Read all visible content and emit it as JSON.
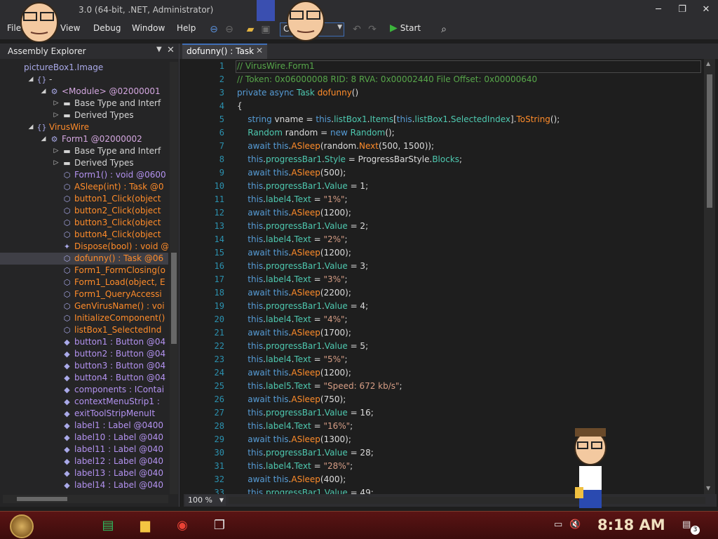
{
  "window": {
    "title": "3.0 (64-bit, .NET, Administrator)",
    "min_glyph": "─",
    "max_glyph": "❐",
    "close_glyph": "✕"
  },
  "menu": {
    "file": "File",
    "view": "View",
    "debug": "Debug",
    "window": "Window",
    "help": "Help"
  },
  "toolbar": {
    "language": "C#",
    "start_label": "Start"
  },
  "assembly_explorer": {
    "title": "Assembly Explorer",
    "rows": [
      {
        "indent": 1,
        "toggle": "",
        "icon": "",
        "icon_name": "resource-icon",
        "text": "pictureBox1.Image",
        "cls": "c-type"
      },
      {
        "indent": 3,
        "toggle": "◢",
        "icon": "{}",
        "icon_name": "namespace-icon",
        "text": "-",
        "cls": "c-ns"
      },
      {
        "indent": 4,
        "toggle": "◢",
        "icon": "⚙",
        "icon_name": "module-icon",
        "text": "<Module> @02000001",
        "cls": "c-mod"
      },
      {
        "indent": 5,
        "toggle": "▷",
        "icon": "▬",
        "icon_name": "folder-icon",
        "text": "Base Type and Interf",
        "cls": "c-folder"
      },
      {
        "indent": 5,
        "toggle": "▷",
        "icon": "▬",
        "icon_name": "folder-icon",
        "text": "Derived Types",
        "cls": "c-folder"
      },
      {
        "indent": 3,
        "toggle": "◢",
        "icon": "{}",
        "icon_name": "namespace-icon",
        "text": "VirusWire",
        "cls": "c-method"
      },
      {
        "indent": 4,
        "toggle": "◢",
        "icon": "⚙",
        "icon_name": "class-icon",
        "text": "Form1 @02000002",
        "cls": "c-mod"
      },
      {
        "indent": 5,
        "toggle": "▷",
        "icon": "▬",
        "icon_name": "folder-icon",
        "text": "Base Type and Interf",
        "cls": "c-folder"
      },
      {
        "indent": 5,
        "toggle": "▷",
        "icon": "▬",
        "icon_name": "folder-icon",
        "text": "Derived Types",
        "cls": "c-folder"
      },
      {
        "indent": 5,
        "toggle": "",
        "icon": "⬡",
        "icon_name": "method-icon",
        "text": "Form1() : void @0600",
        "cls": "c-ctor"
      },
      {
        "indent": 5,
        "toggle": "",
        "icon": "⬡",
        "icon_name": "method-icon",
        "text": "ASleep(int) : Task @0",
        "cls": "c-method"
      },
      {
        "indent": 5,
        "toggle": "",
        "icon": "⬡",
        "icon_name": "method-private-icon",
        "text": "button1_Click(object",
        "cls": "c-method"
      },
      {
        "indent": 5,
        "toggle": "",
        "icon": "⬡",
        "icon_name": "method-private-icon",
        "text": "button2_Click(object",
        "cls": "c-method"
      },
      {
        "indent": 5,
        "toggle": "",
        "icon": "⬡",
        "icon_name": "method-private-icon",
        "text": "button3_Click(object",
        "cls": "c-method"
      },
      {
        "indent": 5,
        "toggle": "",
        "icon": "⬡",
        "icon_name": "method-private-icon",
        "text": "button4_Click(object",
        "cls": "c-method"
      },
      {
        "indent": 5,
        "toggle": "",
        "icon": "✦",
        "icon_name": "override-method-icon",
        "text": "Dispose(bool) : void @",
        "cls": "c-method"
      },
      {
        "indent": 5,
        "toggle": "",
        "icon": "⬡",
        "icon_name": "method-private-icon",
        "text": "dofunny() : Task @06",
        "cls": "c-method",
        "selected": true
      },
      {
        "indent": 5,
        "toggle": "",
        "icon": "⬡",
        "icon_name": "method-private-icon",
        "text": "Form1_FormClosing(o",
        "cls": "c-method"
      },
      {
        "indent": 5,
        "toggle": "",
        "icon": "⬡",
        "icon_name": "method-private-icon",
        "text": "Form1_Load(object, E",
        "cls": "c-method"
      },
      {
        "indent": 5,
        "toggle": "",
        "icon": "⬡",
        "icon_name": "method-private-icon",
        "text": "Form1_QueryAccessi",
        "cls": "c-method"
      },
      {
        "indent": 5,
        "toggle": "",
        "icon": "⬡",
        "icon_name": "method-private-icon",
        "text": "GenVirusName() : voi",
        "cls": "c-method"
      },
      {
        "indent": 5,
        "toggle": "",
        "icon": "⬡",
        "icon_name": "method-private-icon",
        "text": "InitializeComponent()",
        "cls": "c-method"
      },
      {
        "indent": 5,
        "toggle": "",
        "icon": "⬡",
        "icon_name": "method-private-icon",
        "text": "listBox1_SelectedInd",
        "cls": "c-method"
      },
      {
        "indent": 5,
        "toggle": "",
        "icon": "◆",
        "icon_name": "field-icon",
        "text": "button1 : Button @04",
        "cls": "c-field"
      },
      {
        "indent": 5,
        "toggle": "",
        "icon": "◆",
        "icon_name": "field-icon",
        "text": "button2 : Button @04",
        "cls": "c-field"
      },
      {
        "indent": 5,
        "toggle": "",
        "icon": "◆",
        "icon_name": "field-icon",
        "text": "button3 : Button @04",
        "cls": "c-field"
      },
      {
        "indent": 5,
        "toggle": "",
        "icon": "◆",
        "icon_name": "field-icon",
        "text": "button4 : Button @04",
        "cls": "c-field"
      },
      {
        "indent": 5,
        "toggle": "",
        "icon": "◆",
        "icon_name": "field-icon",
        "text": "components : IContai",
        "cls": "c-field"
      },
      {
        "indent": 5,
        "toggle": "",
        "icon": "◆",
        "icon_name": "field-icon",
        "text": "contextMenuStrip1 :",
        "cls": "c-field"
      },
      {
        "indent": 5,
        "toggle": "",
        "icon": "◆",
        "icon_name": "field-icon",
        "text": "exitToolStripMenuIt",
        "cls": "c-field"
      },
      {
        "indent": 5,
        "toggle": "",
        "icon": "◆",
        "icon_name": "field-icon",
        "text": "label1 : Label @0400",
        "cls": "c-field"
      },
      {
        "indent": 5,
        "toggle": "",
        "icon": "◆",
        "icon_name": "field-icon",
        "text": "label10 : Label @040",
        "cls": "c-field"
      },
      {
        "indent": 5,
        "toggle": "",
        "icon": "◆",
        "icon_name": "field-icon",
        "text": "label11 : Label @040",
        "cls": "c-field"
      },
      {
        "indent": 5,
        "toggle": "",
        "icon": "◆",
        "icon_name": "field-icon",
        "text": "label12 : Label @040",
        "cls": "c-field"
      },
      {
        "indent": 5,
        "toggle": "",
        "icon": "◆",
        "icon_name": "field-icon",
        "text": "label13 : Label @040",
        "cls": "c-field"
      },
      {
        "indent": 5,
        "toggle": "",
        "icon": "◆",
        "icon_name": "field-icon",
        "text": "label14 : Label @040",
        "cls": "c-field"
      }
    ]
  },
  "document_tab": {
    "label": "dofunny() : Task",
    "close_glyph": "✕"
  },
  "code": [
    [
      [
        "cm",
        "// VirusWire.Form1"
      ]
    ],
    [
      [
        "cm",
        "// Token: 0x06000008 RID: 8 RVA: 0x00002440 File Offset: 0x00000640"
      ]
    ],
    [
      [
        "kw",
        "private async "
      ],
      [
        "ty",
        "Task "
      ],
      [
        "mt",
        "dofunny"
      ],
      [
        "id",
        "()"
      ]
    ],
    [
      [
        "id",
        "{"
      ]
    ],
    [
      [
        "id",
        "    "
      ],
      [
        "kw",
        "string "
      ],
      [
        "id",
        "vname = "
      ],
      [
        "kw",
        "this"
      ],
      [
        "id",
        "."
      ],
      [
        "pr",
        "listBox1"
      ],
      [
        "id",
        "."
      ],
      [
        "pr",
        "Items"
      ],
      [
        "id",
        "["
      ],
      [
        "kw",
        "this"
      ],
      [
        "id",
        "."
      ],
      [
        "pr",
        "listBox1"
      ],
      [
        "id",
        "."
      ],
      [
        "pr",
        "SelectedIndex"
      ],
      [
        "id",
        "]."
      ],
      [
        "mt",
        "ToString"
      ],
      [
        "id",
        "();"
      ]
    ],
    [
      [
        "id",
        "    "
      ],
      [
        "ty",
        "Random "
      ],
      [
        "id",
        "random = "
      ],
      [
        "kw",
        "new "
      ],
      [
        "ty",
        "Random"
      ],
      [
        "id",
        "();"
      ]
    ],
    [
      [
        "id",
        "    "
      ],
      [
        "kw",
        "await this"
      ],
      [
        "id",
        "."
      ],
      [
        "mt",
        "ASleep"
      ],
      [
        "id",
        "(random."
      ],
      [
        "mt",
        "Next"
      ],
      [
        "id",
        "(500, 1500));"
      ]
    ],
    [
      [
        "id",
        "    "
      ],
      [
        "kw",
        "this"
      ],
      [
        "id",
        "."
      ],
      [
        "pr",
        "progressBar1"
      ],
      [
        "id",
        "."
      ],
      [
        "pr",
        "Style"
      ],
      [
        "id",
        " = ProgressBarStyle."
      ],
      [
        "pr",
        "Blocks"
      ],
      [
        "id",
        ";"
      ]
    ],
    [
      [
        "id",
        "    "
      ],
      [
        "kw",
        "await this"
      ],
      [
        "id",
        "."
      ],
      [
        "mt",
        "ASleep"
      ],
      [
        "id",
        "(500);"
      ]
    ],
    [
      [
        "id",
        "    "
      ],
      [
        "kw",
        "this"
      ],
      [
        "id",
        "."
      ],
      [
        "pr",
        "progressBar1"
      ],
      [
        "id",
        "."
      ],
      [
        "pr",
        "Value"
      ],
      [
        "id",
        " = 1;"
      ]
    ],
    [
      [
        "id",
        "    "
      ],
      [
        "kw",
        "this"
      ],
      [
        "id",
        "."
      ],
      [
        "pr",
        "label4"
      ],
      [
        "id",
        "."
      ],
      [
        "pr",
        "Text"
      ],
      [
        "id",
        " = "
      ],
      [
        "st",
        "\"1%\""
      ],
      [
        "id",
        ";"
      ]
    ],
    [
      [
        "id",
        "    "
      ],
      [
        "kw",
        "await this"
      ],
      [
        "id",
        "."
      ],
      [
        "mt",
        "ASleep"
      ],
      [
        "id",
        "(1200);"
      ]
    ],
    [
      [
        "id",
        "    "
      ],
      [
        "kw",
        "this"
      ],
      [
        "id",
        "."
      ],
      [
        "pr",
        "progressBar1"
      ],
      [
        "id",
        "."
      ],
      [
        "pr",
        "Value"
      ],
      [
        "id",
        " = 2;"
      ]
    ],
    [
      [
        "id",
        "    "
      ],
      [
        "kw",
        "this"
      ],
      [
        "id",
        "."
      ],
      [
        "pr",
        "label4"
      ],
      [
        "id",
        "."
      ],
      [
        "pr",
        "Text"
      ],
      [
        "id",
        " = "
      ],
      [
        "st",
        "\"2%\""
      ],
      [
        "id",
        ";"
      ]
    ],
    [
      [
        "id",
        "    "
      ],
      [
        "kw",
        "await this"
      ],
      [
        "id",
        "."
      ],
      [
        "mt",
        "ASleep"
      ],
      [
        "id",
        "(1200);"
      ]
    ],
    [
      [
        "id",
        "    "
      ],
      [
        "kw",
        "this"
      ],
      [
        "id",
        "."
      ],
      [
        "pr",
        "progressBar1"
      ],
      [
        "id",
        "."
      ],
      [
        "pr",
        "Value"
      ],
      [
        "id",
        " = 3;"
      ]
    ],
    [
      [
        "id",
        "    "
      ],
      [
        "kw",
        "this"
      ],
      [
        "id",
        "."
      ],
      [
        "pr",
        "label4"
      ],
      [
        "id",
        "."
      ],
      [
        "pr",
        "Text"
      ],
      [
        "id",
        " = "
      ],
      [
        "st",
        "\"3%\""
      ],
      [
        "id",
        ";"
      ]
    ],
    [
      [
        "id",
        "    "
      ],
      [
        "kw",
        "await this"
      ],
      [
        "id",
        "."
      ],
      [
        "mt",
        "ASleep"
      ],
      [
        "id",
        "(2200);"
      ]
    ],
    [
      [
        "id",
        "    "
      ],
      [
        "kw",
        "this"
      ],
      [
        "id",
        "."
      ],
      [
        "pr",
        "progressBar1"
      ],
      [
        "id",
        "."
      ],
      [
        "pr",
        "Value"
      ],
      [
        "id",
        " = 4;"
      ]
    ],
    [
      [
        "id",
        "    "
      ],
      [
        "kw",
        "this"
      ],
      [
        "id",
        "."
      ],
      [
        "pr",
        "label4"
      ],
      [
        "id",
        "."
      ],
      [
        "pr",
        "Text"
      ],
      [
        "id",
        " = "
      ],
      [
        "st",
        "\"4%\""
      ],
      [
        "id",
        ";"
      ]
    ],
    [
      [
        "id",
        "    "
      ],
      [
        "kw",
        "await this"
      ],
      [
        "id",
        "."
      ],
      [
        "mt",
        "ASleep"
      ],
      [
        "id",
        "(1700);"
      ]
    ],
    [
      [
        "id",
        "    "
      ],
      [
        "kw",
        "this"
      ],
      [
        "id",
        "."
      ],
      [
        "pr",
        "progressBar1"
      ],
      [
        "id",
        "."
      ],
      [
        "pr",
        "Value"
      ],
      [
        "id",
        " = 5;"
      ]
    ],
    [
      [
        "id",
        "    "
      ],
      [
        "kw",
        "this"
      ],
      [
        "id",
        "."
      ],
      [
        "pr",
        "label4"
      ],
      [
        "id",
        "."
      ],
      [
        "pr",
        "Text"
      ],
      [
        "id",
        " = "
      ],
      [
        "st",
        "\"5%\""
      ],
      [
        "id",
        ";"
      ]
    ],
    [
      [
        "id",
        "    "
      ],
      [
        "kw",
        "await this"
      ],
      [
        "id",
        "."
      ],
      [
        "mt",
        "ASleep"
      ],
      [
        "id",
        "(1200);"
      ]
    ],
    [
      [
        "id",
        "    "
      ],
      [
        "kw",
        "this"
      ],
      [
        "id",
        "."
      ],
      [
        "pr",
        "label5"
      ],
      [
        "id",
        "."
      ],
      [
        "pr",
        "Text"
      ],
      [
        "id",
        " = "
      ],
      [
        "st",
        "\"Speed: 672 kb/s\""
      ],
      [
        "id",
        ";"
      ]
    ],
    [
      [
        "id",
        "    "
      ],
      [
        "kw",
        "await this"
      ],
      [
        "id",
        "."
      ],
      [
        "mt",
        "ASleep"
      ],
      [
        "id",
        "(750);"
      ]
    ],
    [
      [
        "id",
        "    "
      ],
      [
        "kw",
        "this"
      ],
      [
        "id",
        "."
      ],
      [
        "pr",
        "progressBar1"
      ],
      [
        "id",
        "."
      ],
      [
        "pr",
        "Value"
      ],
      [
        "id",
        " = 16;"
      ]
    ],
    [
      [
        "id",
        "    "
      ],
      [
        "kw",
        "this"
      ],
      [
        "id",
        "."
      ],
      [
        "pr",
        "label4"
      ],
      [
        "id",
        "."
      ],
      [
        "pr",
        "Text"
      ],
      [
        "id",
        " = "
      ],
      [
        "st",
        "\"16%\""
      ],
      [
        "id",
        ";"
      ]
    ],
    [
      [
        "id",
        "    "
      ],
      [
        "kw",
        "await this"
      ],
      [
        "id",
        "."
      ],
      [
        "mt",
        "ASleep"
      ],
      [
        "id",
        "(1300);"
      ]
    ],
    [
      [
        "id",
        "    "
      ],
      [
        "kw",
        "this"
      ],
      [
        "id",
        "."
      ],
      [
        "pr",
        "progressBar1"
      ],
      [
        "id",
        "."
      ],
      [
        "pr",
        "Value"
      ],
      [
        "id",
        " = 28;"
      ]
    ],
    [
      [
        "id",
        "    "
      ],
      [
        "kw",
        "this"
      ],
      [
        "id",
        "."
      ],
      [
        "pr",
        "label4"
      ],
      [
        "id",
        "."
      ],
      [
        "pr",
        "Text"
      ],
      [
        "id",
        " = "
      ],
      [
        "st",
        "\"28%\""
      ],
      [
        "id",
        ";"
      ]
    ],
    [
      [
        "id",
        "    "
      ],
      [
        "kw",
        "await this"
      ],
      [
        "id",
        "."
      ],
      [
        "mt",
        "ASleep"
      ],
      [
        "id",
        "(400);"
      ]
    ],
    [
      [
        "id",
        "    "
      ],
      [
        "kw",
        "this"
      ],
      [
        "id",
        "."
      ],
      [
        "pr",
        "progressBar1"
      ],
      [
        "id",
        "."
      ],
      [
        "pr",
        "Value"
      ],
      [
        "id",
        " = 49;"
      ]
    ]
  ],
  "zoom": {
    "value": "100 %"
  },
  "taskbar": {
    "clock": "8:18 AM",
    "notification_count": "3",
    "apps": [
      {
        "name": "evernote-icon",
        "glyph": "▤",
        "color": "#2dbe60"
      },
      {
        "name": "file-explorer-icon",
        "glyph": "▆",
        "color": "#f4c542"
      },
      {
        "name": "chrome-icon",
        "glyph": "◉",
        "color": "#e94235"
      },
      {
        "name": "task-view-icon",
        "glyph": "❐",
        "color": "#e0e0e0"
      }
    ]
  }
}
